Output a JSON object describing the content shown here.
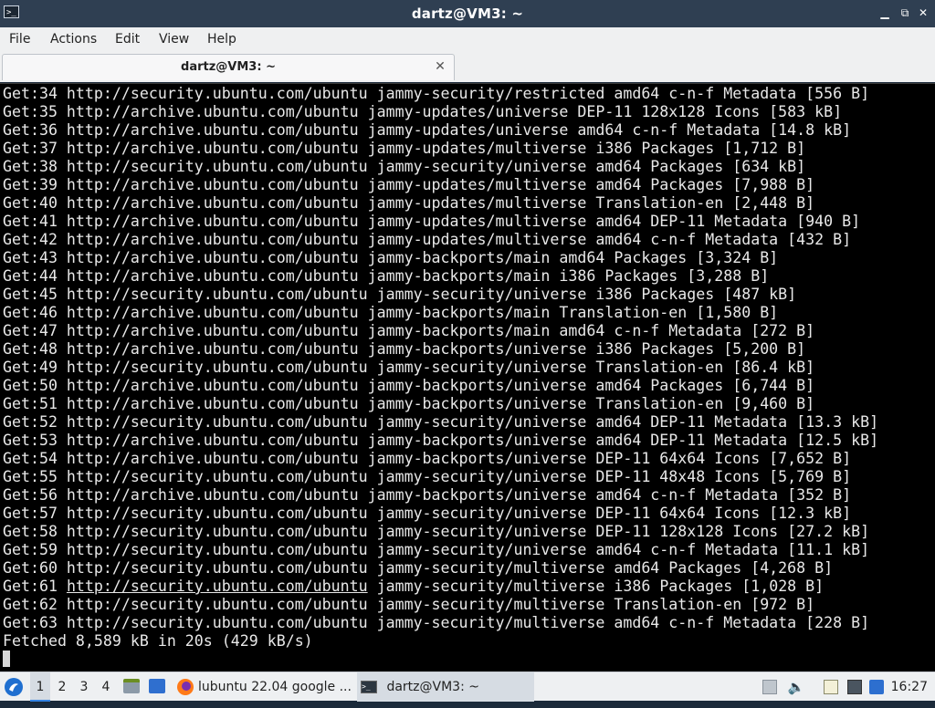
{
  "window": {
    "title": "dartz@VM3: ~",
    "icon": "terminal-icon",
    "buttons": [
      "minimize-icon",
      "restore-icon",
      "close-icon"
    ]
  },
  "menu": [
    "File",
    "Actions",
    "Edit",
    "View",
    "Help"
  ],
  "tab": {
    "label": "dartz@VM3: ~",
    "close_glyph": "✕"
  },
  "terminal_lines": [
    "Get:34 http://security.ubuntu.com/ubuntu jammy-security/restricted amd64 c-n-f Metadata [556 B]",
    "Get:35 http://archive.ubuntu.com/ubuntu jammy-updates/universe DEP-11 128x128 Icons [583 kB]",
    "Get:36 http://archive.ubuntu.com/ubuntu jammy-updates/universe amd64 c-n-f Metadata [14.8 kB]",
    "Get:37 http://archive.ubuntu.com/ubuntu jammy-updates/multiverse i386 Packages [1,712 B]",
    "Get:38 http://security.ubuntu.com/ubuntu jammy-security/universe amd64 Packages [634 kB]",
    "Get:39 http://archive.ubuntu.com/ubuntu jammy-updates/multiverse amd64 Packages [7,988 B]",
    "Get:40 http://archive.ubuntu.com/ubuntu jammy-updates/multiverse Translation-en [2,448 B]",
    "Get:41 http://archive.ubuntu.com/ubuntu jammy-updates/multiverse amd64 DEP-11 Metadata [940 B]",
    "Get:42 http://archive.ubuntu.com/ubuntu jammy-updates/multiverse amd64 c-n-f Metadata [432 B]",
    "Get:43 http://archive.ubuntu.com/ubuntu jammy-backports/main amd64 Packages [3,324 B]",
    "Get:44 http://archive.ubuntu.com/ubuntu jammy-backports/main i386 Packages [3,288 B]",
    "Get:45 http://security.ubuntu.com/ubuntu jammy-security/universe i386 Packages [487 kB]",
    "Get:46 http://archive.ubuntu.com/ubuntu jammy-backports/main Translation-en [1,580 B]",
    "Get:47 http://archive.ubuntu.com/ubuntu jammy-backports/main amd64 c-n-f Metadata [272 B]",
    "Get:48 http://archive.ubuntu.com/ubuntu jammy-backports/universe i386 Packages [5,200 B]",
    "Get:49 http://security.ubuntu.com/ubuntu jammy-security/universe Translation-en [86.4 kB]",
    "Get:50 http://archive.ubuntu.com/ubuntu jammy-backports/universe amd64 Packages [6,744 B]",
    "Get:51 http://archive.ubuntu.com/ubuntu jammy-backports/universe Translation-en [9,460 B]",
    "Get:52 http://security.ubuntu.com/ubuntu jammy-security/universe amd64 DEP-11 Metadata [13.3 kB]",
    "Get:53 http://archive.ubuntu.com/ubuntu jammy-backports/universe amd64 DEP-11 Metadata [12.5 kB]",
    "Get:54 http://archive.ubuntu.com/ubuntu jammy-backports/universe DEP-11 64x64 Icons [7,652 B]",
    "Get:55 http://security.ubuntu.com/ubuntu jammy-security/universe DEP-11 48x48 Icons [5,769 B]",
    "Get:56 http://archive.ubuntu.com/ubuntu jammy-backports/universe amd64 c-n-f Metadata [352 B]",
    "Get:57 http://security.ubuntu.com/ubuntu jammy-security/universe DEP-11 64x64 Icons [12.3 kB]",
    "Get:58 http://security.ubuntu.com/ubuntu jammy-security/universe DEP-11 128x128 Icons [27.2 kB]",
    "Get:59 http://security.ubuntu.com/ubuntu jammy-security/universe amd64 c-n-f Metadata [11.1 kB]",
    "Get:60 http://security.ubuntu.com/ubuntu jammy-security/multiverse amd64 Packages [4,268 B]",
    "Get:61 http://security.ubuntu.com/ubuntu jammy-security/multiverse i386 Packages [1,028 B]",
    "Get:62 http://security.ubuntu.com/ubuntu jammy-security/multiverse Translation-en [972 B]",
    "Get:63 http://security.ubuntu.com/ubuntu jammy-security/multiverse amd64 c-n-f Metadata [228 B]",
    "Fetched 8,589 kB in 20s (429 kB/s)"
  ],
  "underlined_link": {
    "line_index": 27,
    "text": "http://security.ubuntu.com/ubuntu"
  },
  "taskbar": {
    "start_icon": "lubuntu-menu-icon",
    "desktops": [
      "1",
      "2",
      "3",
      "4"
    ],
    "active_desktop": "1",
    "quicklaunch": [
      "file-manager-icon",
      "show-desktop-icon",
      "firefox-icon"
    ],
    "tasks": [
      {
        "label": "lubuntu 22.04 google ...",
        "icon": "firefox-icon",
        "active": false
      },
      {
        "label": "dartz@VM3: ~",
        "icon": "terminal-icon",
        "active": true
      }
    ],
    "tray": [
      "removable-media-icon",
      "volume-icon",
      "clipboard-icon",
      "network-icon",
      "update-notifier-icon"
    ],
    "clock": "16:27"
  },
  "colors": {
    "titlebar": "#2f3f52",
    "terminal_bg": "#000000",
    "terminal_fg": "#e8e8e8",
    "accent": "#3584e4"
  }
}
